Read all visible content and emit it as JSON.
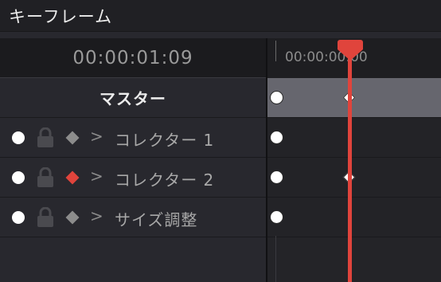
{
  "panel": {
    "title": "キーフレーム"
  },
  "timecode": "00:00:01:09",
  "ruler": {
    "label": "00:00:00:00"
  },
  "master": {
    "label": "マスター"
  },
  "tracks": [
    {
      "label": "コレクター 1",
      "keyframe_color": "#8c8c8c",
      "has_keyframe_marker": false
    },
    {
      "label": "コレクター 2",
      "keyframe_color": "#e0443c",
      "has_keyframe_marker": true
    },
    {
      "label": "サイズ調整",
      "keyframe_color": "#8c8c8c",
      "has_keyframe_marker": false
    }
  ],
  "colors": {
    "playhead": "#e0443c",
    "master_row": "#66666e",
    "background": "#28282e"
  }
}
